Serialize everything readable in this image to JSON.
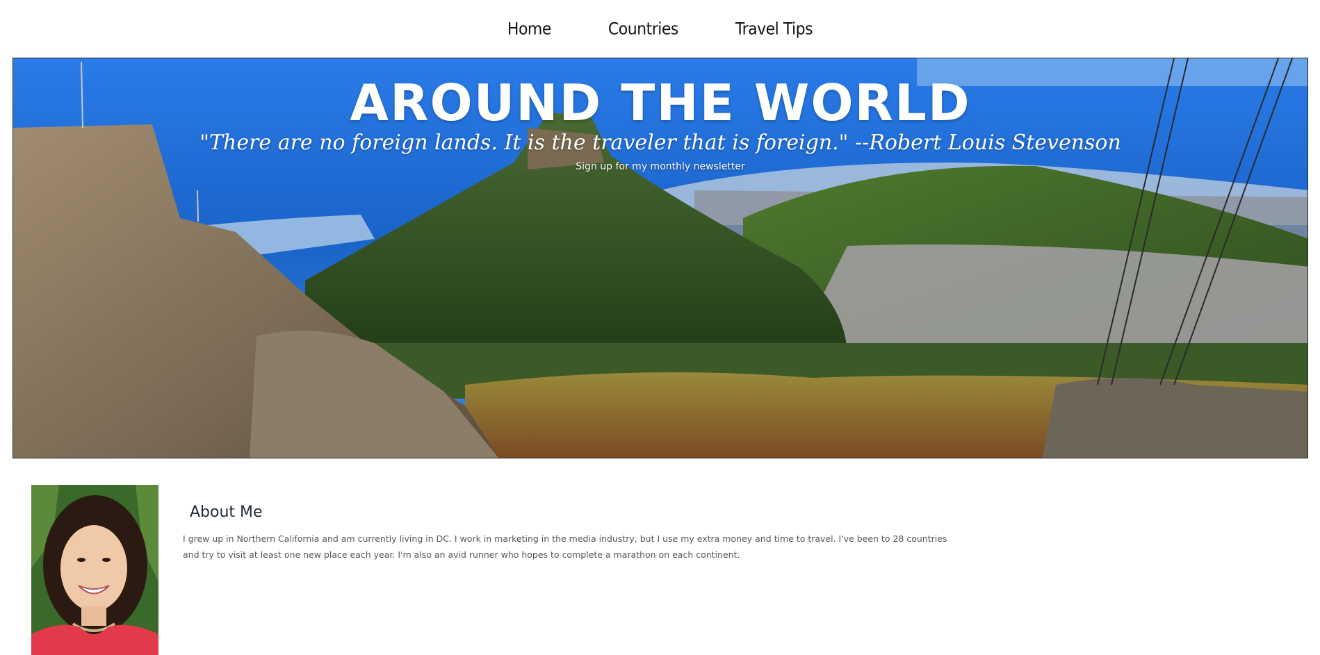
{
  "nav": {
    "items": [
      {
        "label": "Home"
      },
      {
        "label": "Countries"
      },
      {
        "label": "Travel Tips"
      }
    ]
  },
  "hero": {
    "title": "AROUND THE WORLD",
    "quote": "\"There are no foreign lands. It is the traveler that is foreign.\" --Robert Louis Stevenson",
    "signup_link": "Sign up for my monthly newsletter"
  },
  "about": {
    "heading": "About Me",
    "body": "I grew up in Northern California and am currently living in DC. I work in marketing in the media industry, but I use my extra money and time to travel. I've been to 28 countries and try to visit at least one new place each year. I'm also an avid runner who hopes to complete a marathon on each continent."
  },
  "colors": {
    "sky_ocean": "#1f6fd6",
    "mountain_green": "#3d5a2a",
    "rock": "#8a7a66",
    "text_dark": "#1e2b3a",
    "body_text": "#555555"
  }
}
